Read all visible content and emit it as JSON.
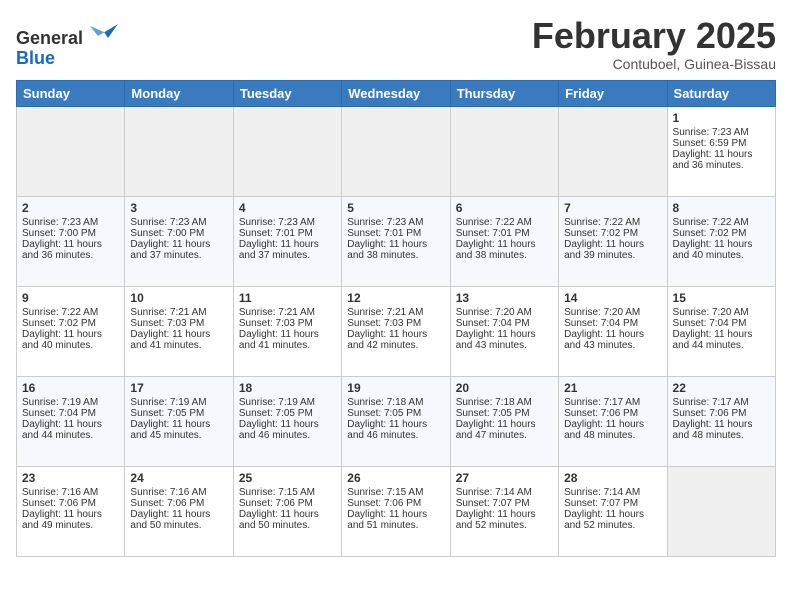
{
  "header": {
    "logo_line1": "General",
    "logo_line2": "Blue",
    "month_title": "February 2025",
    "location": "Contuboel, Guinea-Bissau"
  },
  "calendar": {
    "days_of_week": [
      "Sunday",
      "Monday",
      "Tuesday",
      "Wednesday",
      "Thursday",
      "Friday",
      "Saturday"
    ],
    "weeks": [
      [
        {
          "day": "",
          "empty": true
        },
        {
          "day": "",
          "empty": true
        },
        {
          "day": "",
          "empty": true
        },
        {
          "day": "",
          "empty": true
        },
        {
          "day": "",
          "empty": true
        },
        {
          "day": "",
          "empty": true
        },
        {
          "day": "1",
          "rise": "7:23 AM",
          "set": "6:59 PM",
          "daylight": "11 hours and 36 minutes."
        }
      ],
      [
        {
          "day": "2",
          "rise": "7:23 AM",
          "set": "7:00 PM",
          "daylight": "11 hours and 36 minutes."
        },
        {
          "day": "3",
          "rise": "7:23 AM",
          "set": "7:00 PM",
          "daylight": "11 hours and 37 minutes."
        },
        {
          "day": "4",
          "rise": "7:23 AM",
          "set": "7:01 PM",
          "daylight": "11 hours and 37 minutes."
        },
        {
          "day": "5",
          "rise": "7:23 AM",
          "set": "7:01 PM",
          "daylight": "11 hours and 38 minutes."
        },
        {
          "day": "6",
          "rise": "7:22 AM",
          "set": "7:01 PM",
          "daylight": "11 hours and 38 minutes."
        },
        {
          "day": "7",
          "rise": "7:22 AM",
          "set": "7:02 PM",
          "daylight": "11 hours and 39 minutes."
        },
        {
          "day": "8",
          "rise": "7:22 AM",
          "set": "7:02 PM",
          "daylight": "11 hours and 40 minutes."
        }
      ],
      [
        {
          "day": "9",
          "rise": "7:22 AM",
          "set": "7:02 PM",
          "daylight": "11 hours and 40 minutes."
        },
        {
          "day": "10",
          "rise": "7:21 AM",
          "set": "7:03 PM",
          "daylight": "11 hours and 41 minutes."
        },
        {
          "day": "11",
          "rise": "7:21 AM",
          "set": "7:03 PM",
          "daylight": "11 hours and 41 minutes."
        },
        {
          "day": "12",
          "rise": "7:21 AM",
          "set": "7:03 PM",
          "daylight": "11 hours and 42 minutes."
        },
        {
          "day": "13",
          "rise": "7:20 AM",
          "set": "7:04 PM",
          "daylight": "11 hours and 43 minutes."
        },
        {
          "day": "14",
          "rise": "7:20 AM",
          "set": "7:04 PM",
          "daylight": "11 hours and 43 minutes."
        },
        {
          "day": "15",
          "rise": "7:20 AM",
          "set": "7:04 PM",
          "daylight": "11 hours and 44 minutes."
        }
      ],
      [
        {
          "day": "16",
          "rise": "7:19 AM",
          "set": "7:04 PM",
          "daylight": "11 hours and 44 minutes."
        },
        {
          "day": "17",
          "rise": "7:19 AM",
          "set": "7:05 PM",
          "daylight": "11 hours and 45 minutes."
        },
        {
          "day": "18",
          "rise": "7:19 AM",
          "set": "7:05 PM",
          "daylight": "11 hours and 46 minutes."
        },
        {
          "day": "19",
          "rise": "7:18 AM",
          "set": "7:05 PM",
          "daylight": "11 hours and 46 minutes."
        },
        {
          "day": "20",
          "rise": "7:18 AM",
          "set": "7:05 PM",
          "daylight": "11 hours and 47 minutes."
        },
        {
          "day": "21",
          "rise": "7:17 AM",
          "set": "7:06 PM",
          "daylight": "11 hours and 48 minutes."
        },
        {
          "day": "22",
          "rise": "7:17 AM",
          "set": "7:06 PM",
          "daylight": "11 hours and 48 minutes."
        }
      ],
      [
        {
          "day": "23",
          "rise": "7:16 AM",
          "set": "7:06 PM",
          "daylight": "11 hours and 49 minutes."
        },
        {
          "day": "24",
          "rise": "7:16 AM",
          "set": "7:06 PM",
          "daylight": "11 hours and 50 minutes."
        },
        {
          "day": "25",
          "rise": "7:15 AM",
          "set": "7:06 PM",
          "daylight": "11 hours and 50 minutes."
        },
        {
          "day": "26",
          "rise": "7:15 AM",
          "set": "7:06 PM",
          "daylight": "11 hours and 51 minutes."
        },
        {
          "day": "27",
          "rise": "7:14 AM",
          "set": "7:07 PM",
          "daylight": "11 hours and 52 minutes."
        },
        {
          "day": "28",
          "rise": "7:14 AM",
          "set": "7:07 PM",
          "daylight": "11 hours and 52 minutes."
        },
        {
          "day": "",
          "empty": true
        }
      ]
    ]
  }
}
